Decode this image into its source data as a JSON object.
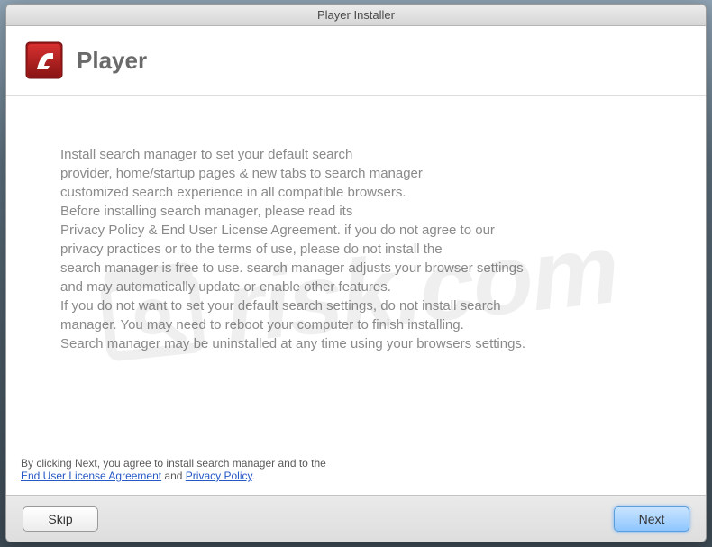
{
  "window": {
    "title": "Player Installer"
  },
  "header": {
    "app_name": "Player"
  },
  "body": {
    "lines": [
      "Install search manager to set your default search",
      "provider, home/startup pages & new tabs to search manager",
      "customized search experience in all compatible browsers.",
      "Before installing search manager, please read its",
      "Privacy Policy & End User License Agreement. if you do not agree to our",
      "privacy practices or to the terms of use, please do not install the",
      "search manager is free to use. search manager adjusts your browser settings",
      "and may automatically update or enable other features.",
      "If you do not want to set your default search settings, do not install search",
      "manager. You may need to reboot your computer to finish installing.",
      "Search manager may be uninstalled at any time using your browsers settings."
    ]
  },
  "footer": {
    "prefix": "By clicking Next, you agree to install search manager and to the",
    "link1": "End User License Agreement",
    "and": " and ",
    "link2": "Privacy Policy",
    "suffix": "."
  },
  "buttons": {
    "skip": "Skip",
    "next": "Next"
  },
  "watermark": {
    "text": "risk.com"
  }
}
